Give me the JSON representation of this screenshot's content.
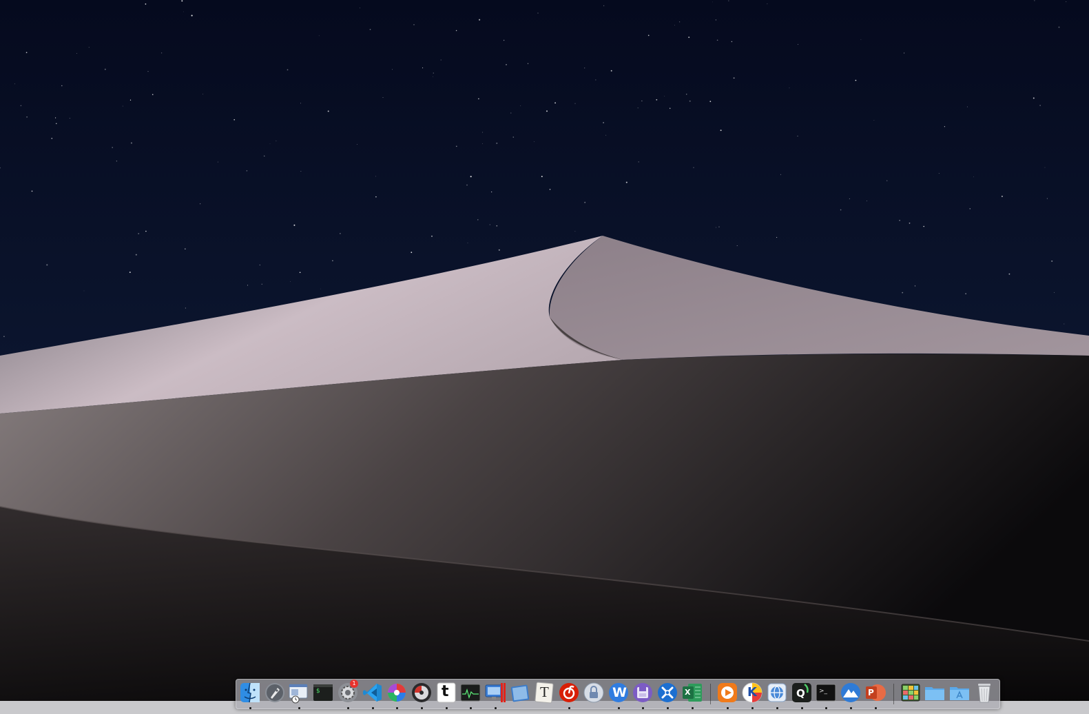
{
  "desktop": {
    "wallpaper": "Mojave dunes at night",
    "colors": {
      "sky_top": "#050a1e",
      "sky_bottom": "#12203e",
      "dune_lit": "#c9bcc3",
      "dune_shadow": "#08070a"
    }
  },
  "dock": {
    "apps": [
      {
        "name": "Finder",
        "icon": "finder-icon",
        "running": true
      },
      {
        "name": "Launchpad",
        "icon": "launchpad-icon",
        "running": false
      },
      {
        "name": "Window Manager",
        "icon": "window-manager-icon",
        "running": true
      },
      {
        "name": "Terminal Script",
        "icon": "terminal-script-icon",
        "running": false
      },
      {
        "name": "System Preferences",
        "icon": "system-preferences-icon",
        "running": true,
        "badge": "1"
      },
      {
        "name": "Visual Studio Code",
        "icon": "vscode-icon",
        "running": true
      },
      {
        "name": "Color Picker",
        "icon": "color-wheel-icon",
        "running": true
      },
      {
        "name": "Disk Utility",
        "icon": "disk-utility-icon",
        "running": true
      },
      {
        "name": "Typora",
        "icon": "typora-icon",
        "running": true
      },
      {
        "name": "Activity Monitor",
        "icon": "activity-monitor-icon",
        "running": true
      },
      {
        "name": "Screen Recorder",
        "icon": "screen-recorder-icon",
        "running": true
      },
      {
        "name": "Note Book",
        "icon": "notebook-icon",
        "running": false
      },
      {
        "name": "Text Editor",
        "icon": "text-editor-icon",
        "running": false
      },
      {
        "name": "NetEase Music",
        "icon": "netease-music-icon",
        "running": true
      },
      {
        "name": "Password Lock",
        "icon": "lock-icon",
        "running": false
      },
      {
        "name": "Word",
        "icon": "word-icon",
        "running": true
      },
      {
        "name": "Floppy Save",
        "icon": "floppy-icon",
        "running": true
      },
      {
        "name": "Xmind",
        "icon": "xmind-icon",
        "running": true
      },
      {
        "name": "Excel",
        "icon": "excel-icon",
        "running": true
      },
      {
        "name": "Media Player",
        "icon": "media-player-icon",
        "running": true
      },
      {
        "name": "Keynote K",
        "icon": "k-app-icon",
        "running": true
      },
      {
        "name": "Network Utility",
        "icon": "network-globe-icon",
        "running": true
      },
      {
        "name": "V2Ray",
        "icon": "v2ray-icon",
        "running": true
      },
      {
        "name": "Terminal",
        "icon": "terminal-icon",
        "running": true
      },
      {
        "name": "Mountain App",
        "icon": "mountain-icon",
        "running": true
      },
      {
        "name": "PowerPoint",
        "icon": "powerpoint-icon",
        "running": true
      },
      {
        "name": "Grid Stack",
        "icon": "grid-stack-icon",
        "running": false
      },
      {
        "name": "Folder",
        "icon": "folder-icon",
        "running": false
      },
      {
        "name": "Applications",
        "icon": "applications-folder-icon",
        "running": false
      },
      {
        "name": "Trash",
        "icon": "trash-icon",
        "running": false
      }
    ],
    "texts": {
      "terminal_script": "$",
      "typora": "t",
      "text_editor": "T",
      "word": "W",
      "excel": "X",
      "k_app": "K",
      "v2ray": "Q",
      "terminal": ">_",
      "powerpoint": "P",
      "sys_badge": "1"
    }
  }
}
